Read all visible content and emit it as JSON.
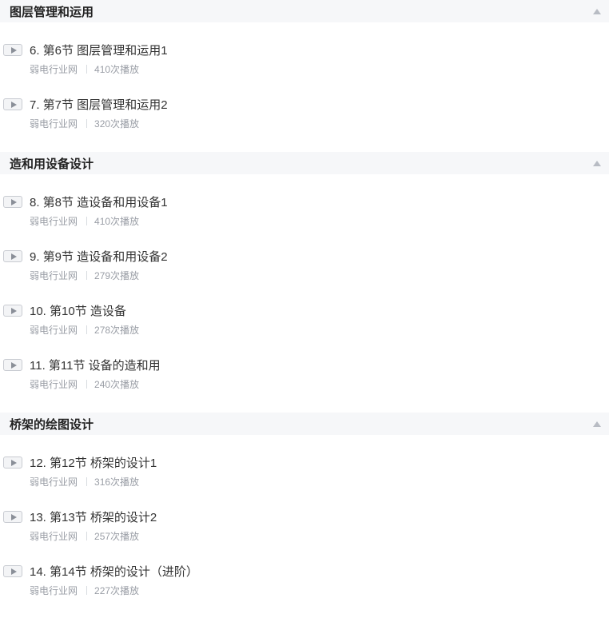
{
  "sections": [
    {
      "title": "图层管理和运用",
      "lessons": [
        {
          "title": "6. 第6节 图层管理和运用1",
          "author": "弱电行业网",
          "plays": "410次播放"
        },
        {
          "title": "7. 第7节 图层管理和运用2",
          "author": "弱电行业网",
          "plays": "320次播放"
        }
      ]
    },
    {
      "title": "造和用设备设计",
      "lessons": [
        {
          "title": "8. 第8节 造设备和用设备1",
          "author": "弱电行业网",
          "plays": "410次播放"
        },
        {
          "title": "9. 第9节 造设备和用设备2",
          "author": "弱电行业网",
          "plays": "279次播放"
        },
        {
          "title": "10. 第10节 造设备",
          "author": "弱电行业网",
          "plays": "278次播放"
        },
        {
          "title": "11. 第11节 设备的造和用",
          "author": "弱电行业网",
          "plays": "240次播放"
        }
      ]
    },
    {
      "title": "桥架的绘图设计",
      "lessons": [
        {
          "title": "12. 第12节 桥架的设计1",
          "author": "弱电行业网",
          "plays": "316次播放"
        },
        {
          "title": "13. 第13节 桥架的设计2",
          "author": "弱电行业网",
          "plays": "257次播放"
        },
        {
          "title": "14. 第14节 桥架的设计（进阶）",
          "author": "弱电行业网",
          "plays": "227次播放"
        }
      ]
    }
  ]
}
